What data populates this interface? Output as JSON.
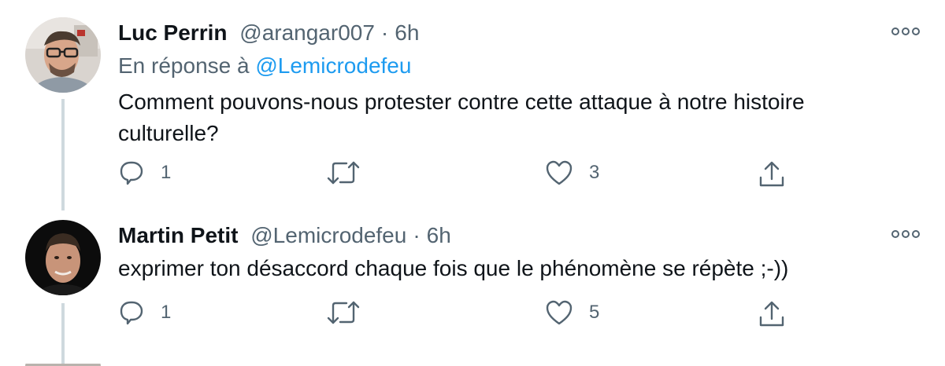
{
  "tweets": [
    {
      "author_name": "Luc Perrin",
      "handle": "@arangar007",
      "separator": "·",
      "time": "6h",
      "reply_prefix": "En réponse à",
      "reply_mention": "@Lemicrodefeu",
      "text": "Comment pouvons-nous protester contre cette attaque à notre histoire culturelle?",
      "reply_count": "1",
      "retweet_count": "",
      "like_count": "3"
    },
    {
      "author_name": "Martin Petit",
      "handle": "@Lemicrodefeu",
      "separator": "·",
      "time": "6h",
      "text": "exprimer ton désaccord chaque fois que le phénomène se répète ;-))",
      "reply_count": "1",
      "retweet_count": "",
      "like_count": "5"
    }
  ],
  "icons": {
    "reply": "reply-icon",
    "retweet": "retweet-icon",
    "like": "heart-icon",
    "share": "share-icon",
    "more": "more-icon"
  },
  "colors": {
    "text": "#0f1419",
    "secondary": "#536471",
    "link": "#1d9bf0",
    "thread_line": "#cfd9de"
  }
}
